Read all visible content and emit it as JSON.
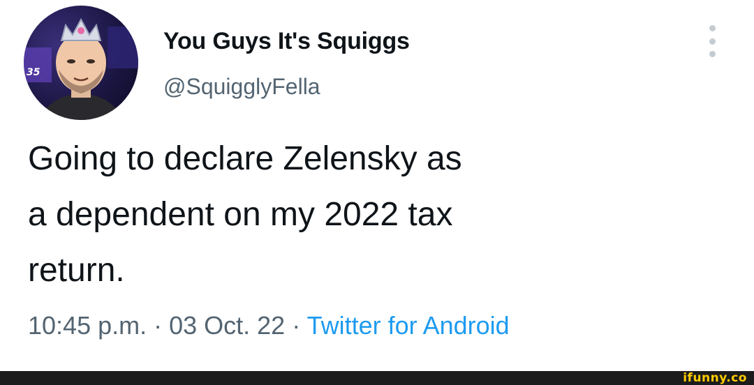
{
  "tweet": {
    "display_name": "You Guys It's Squiggs",
    "handle": "@SquigglyFella",
    "text": "Going to declare Zelensky as\na dependent on my 2022 tax\nreturn.",
    "time": "10:45 p.m.",
    "separator": " · ",
    "date": "03 Oct. 22",
    "source": "Twitter for Android",
    "avatar_icon": "profile-photo-crown"
  },
  "footer": {
    "brand": "ifunny.co"
  },
  "colors": {
    "name": "#0f1419",
    "secondary": "#536471",
    "link": "#1d9bf0",
    "footer_bg": "#1c1c1c",
    "brand": "#ffcc00"
  }
}
